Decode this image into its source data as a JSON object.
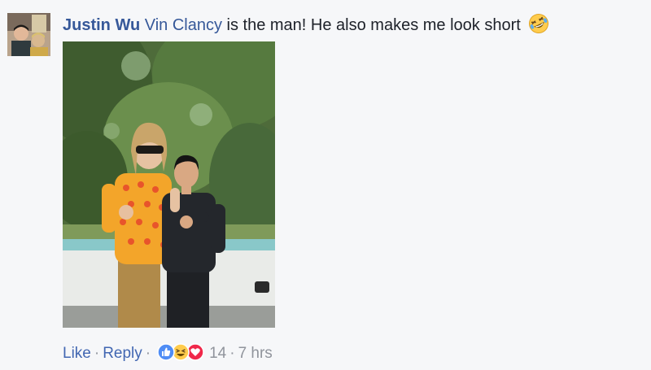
{
  "comment": {
    "author": "Justin Wu",
    "mention": "Vin Clancy",
    "text": " is the man! He also makes me look short",
    "emoji": "rolling-on-floor-laughing-emoji"
  },
  "actions": {
    "like_label": "Like",
    "separator": "·",
    "reply_label": "Reply",
    "reaction_icons": [
      "like-reaction-icon",
      "haha-reaction-icon",
      "love-reaction-icon"
    ],
    "reaction_count": "14",
    "timestamp": "7 hrs"
  },
  "colors": {
    "author": "#365899",
    "link": "#4267b2",
    "meta": "#90949c",
    "text": "#1d2129",
    "background": "#f6f7f9"
  }
}
